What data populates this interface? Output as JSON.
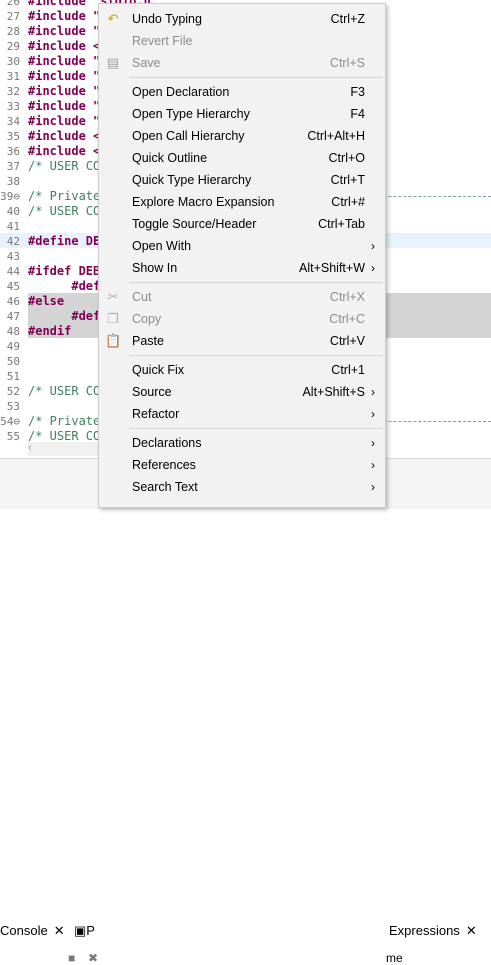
{
  "editor": {
    "lines": [
      {
        "n": "26",
        "text": "#include \"stdio.h\""
      },
      {
        "n": "27",
        "text": "#include \""
      },
      {
        "n": "28",
        "text": "#include \""
      },
      {
        "n": "29",
        "text": "#include <"
      },
      {
        "n": "30",
        "text": "#include \""
      },
      {
        "n": "31",
        "text": "#include \""
      },
      {
        "n": "32",
        "text": "#include \""
      },
      {
        "n": "33",
        "text": "#include \""
      },
      {
        "n": "34",
        "text": "#include \""
      },
      {
        "n": "35",
        "text": "#include <"
      },
      {
        "n": "36",
        "text": "#include <"
      },
      {
        "n": "37",
        "text": "/* USER CO"
      },
      {
        "n": "38",
        "text": ""
      },
      {
        "n": "39⊖",
        "text": "/* Private"
      },
      {
        "n": "40",
        "text": "/* USER CO"
      },
      {
        "n": "41",
        "text": ""
      },
      {
        "n": "42",
        "text": "#define DE"
      },
      {
        "n": "43",
        "text": ""
      },
      {
        "n": "44",
        "text": "#ifdef DEB"
      },
      {
        "n": "45",
        "text": "      #def"
      },
      {
        "n": "46",
        "text": "#else"
      },
      {
        "n": "47",
        "text": "      #def"
      },
      {
        "n": "48",
        "text": "#endif"
      },
      {
        "n": "49",
        "text": ""
      },
      {
        "n": "50",
        "text": ""
      },
      {
        "n": "51",
        "text": ""
      },
      {
        "n": "52",
        "text": "/* USER CO"
      },
      {
        "n": "53",
        "text": ""
      },
      {
        "n": "54⊖",
        "text": "/* Private"
      },
      {
        "n": "55",
        "text": "/* USER CO"
      }
    ]
  },
  "bottom_tabs": {
    "console": "Console",
    "problems_fragment": "P",
    "expressions": "Expressions",
    "name_fragment": "me",
    "close": "✕"
  },
  "menu": {
    "undo_typing": {
      "label": "Undo Typing",
      "shortcut": "Ctrl+Z"
    },
    "revert_file": {
      "label": "Revert File"
    },
    "save": {
      "label": "Save",
      "shortcut": "Ctrl+S"
    },
    "open_declaration": {
      "label": "Open Declaration",
      "shortcut": "F3"
    },
    "open_type_hierarchy": {
      "label": "Open Type Hierarchy",
      "shortcut": "F4"
    },
    "open_call_hierarchy": {
      "label": "Open Call Hierarchy",
      "shortcut": "Ctrl+Alt+H"
    },
    "quick_outline": {
      "label": "Quick Outline",
      "shortcut": "Ctrl+O"
    },
    "quick_type_hierarchy": {
      "label": "Quick Type Hierarchy",
      "shortcut": "Ctrl+T"
    },
    "explore_macro": {
      "label": "Explore Macro Expansion",
      "shortcut": "Ctrl+#"
    },
    "toggle_source_header": {
      "label": "Toggle Source/Header",
      "shortcut": "Ctrl+Tab"
    },
    "open_with": {
      "label": "Open With"
    },
    "show_in": {
      "label": "Show In",
      "shortcut": "Alt+Shift+W"
    },
    "cut": {
      "label": "Cut",
      "shortcut": "Ctrl+X"
    },
    "copy": {
      "label": "Copy",
      "shortcut": "Ctrl+C"
    },
    "paste": {
      "label": "Paste",
      "shortcut": "Ctrl+V"
    },
    "quick_fix": {
      "label": "Quick Fix",
      "shortcut": "Ctrl+1"
    },
    "source": {
      "label": "Source",
      "shortcut": "Alt+Shift+S"
    },
    "refactor": {
      "label": "Refactor"
    },
    "declarations": {
      "label": "Declarations"
    },
    "references": {
      "label": "References"
    },
    "search_text": {
      "label": "Search Text"
    },
    "submenu_arrow": "›"
  },
  "colors": {
    "menu_bg": "#f2f2f2",
    "keyword": "#7f0055",
    "comment": "#3f7f5f",
    "disabled": "#8c8c8c"
  }
}
